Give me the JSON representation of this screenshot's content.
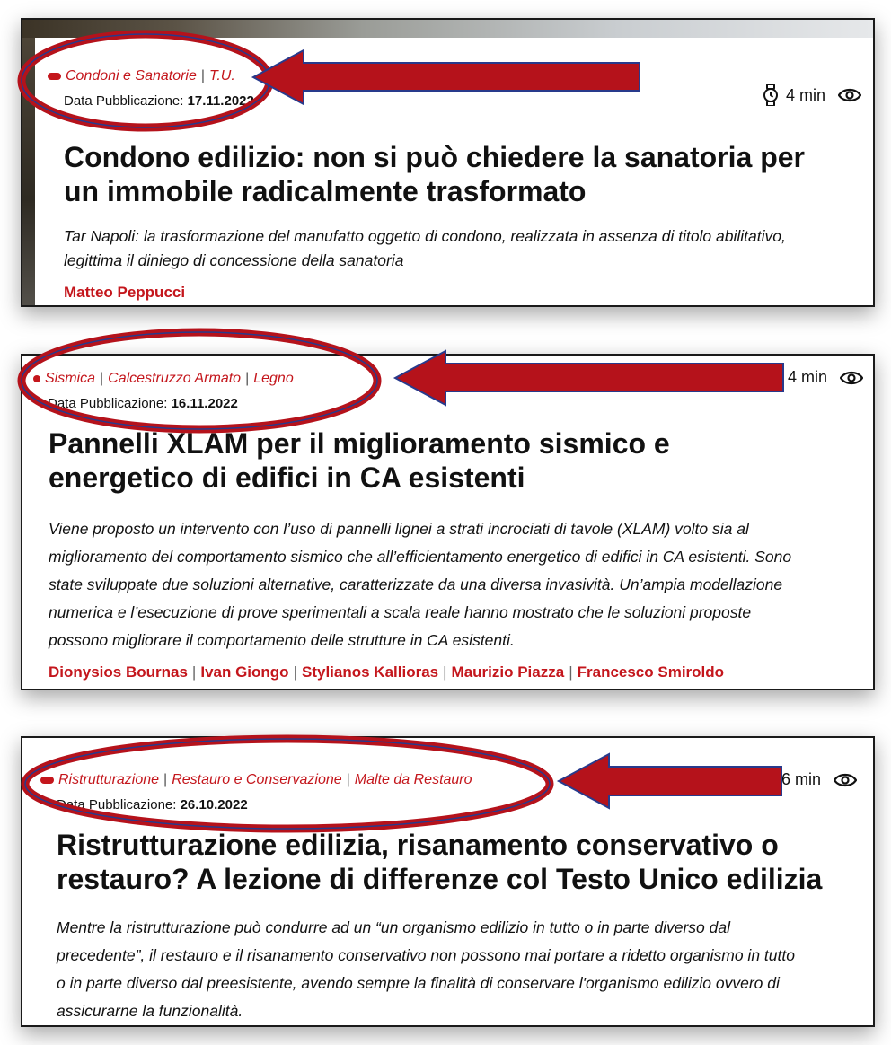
{
  "accent_color": "#c4161c",
  "annotation_color": "#b5121b",
  "articles": [
    {
      "categories": [
        "Condoni e Sanatorie",
        "T.U."
      ],
      "date_label": "Data Pubblicazione:",
      "date_value": "17.11.2022",
      "read_time": "4 min",
      "title_lines": [
        "Condono edilizio: non si può chiedere la sanatoria per",
        "un immobile radicalmente trasformato"
      ],
      "desc_lines": [
        "Tar Napoli: la trasformazione del manufatto oggetto di condono, realizzata in assenza di titolo abilitativo,",
        "legittima il diniego di concessione della sanatoria"
      ],
      "authors": [
        "Matteo Peppucci"
      ]
    },
    {
      "categories": [
        "Sismica",
        "Calcestruzzo Armato",
        "Legno"
      ],
      "date_label": "Data Pubblicazione:",
      "date_value": "16.11.2022",
      "read_time": "4 min",
      "title_lines": [
        "Pannelli XLAM per il miglioramento sismico e",
        "energetico di edifici in CA esistenti"
      ],
      "desc_lines": [
        "Viene proposto un intervento con l’uso di pannelli lignei a strati incrociati di tavole (XLAM) volto sia al",
        "miglioramento del comportamento sismico che all’efficientamento energetico di edifici in CA esistenti. Sono",
        "state sviluppate due soluzioni alternative, caratterizzate da una diversa invasività. Un’ampia modellazione",
        "numerica e l’esecuzione di prove sperimentali a scala reale hanno mostrato che le soluzioni proposte",
        "possono migliorare il comportamento delle strutture in CA esistenti."
      ],
      "authors": [
        "Dionysios Bournas",
        "Ivan Giongo",
        "Stylianos Kallioras",
        "Maurizio Piazza",
        "Francesco Smiroldo"
      ]
    },
    {
      "categories": [
        "Ristrutturazione",
        "Restauro e Conservazione",
        "Malte da Restauro"
      ],
      "date_label": "Data Pubblicazione:",
      "date_value": "26.10.2022",
      "read_time": "6 min",
      "title_lines": [
        "Ristrutturazione edilizia, risanamento conservativo o",
        "restauro? A lezione di differenze col Testo Unico edilizia"
      ],
      "desc_lines": [
        "Mentre la ristrutturazione può condurre ad un “un organismo edilizio in tutto o in parte diverso dal",
        "precedente”, il restauro e il risanamento conservativo non possono mai portare a ridetto organismo in tutto",
        "o in parte diverso dal preesistente, avendo sempre la finalità di conservare l'organismo edilizio ovvero di",
        "assicurarne la funzionalità."
      ],
      "authors": []
    }
  ]
}
